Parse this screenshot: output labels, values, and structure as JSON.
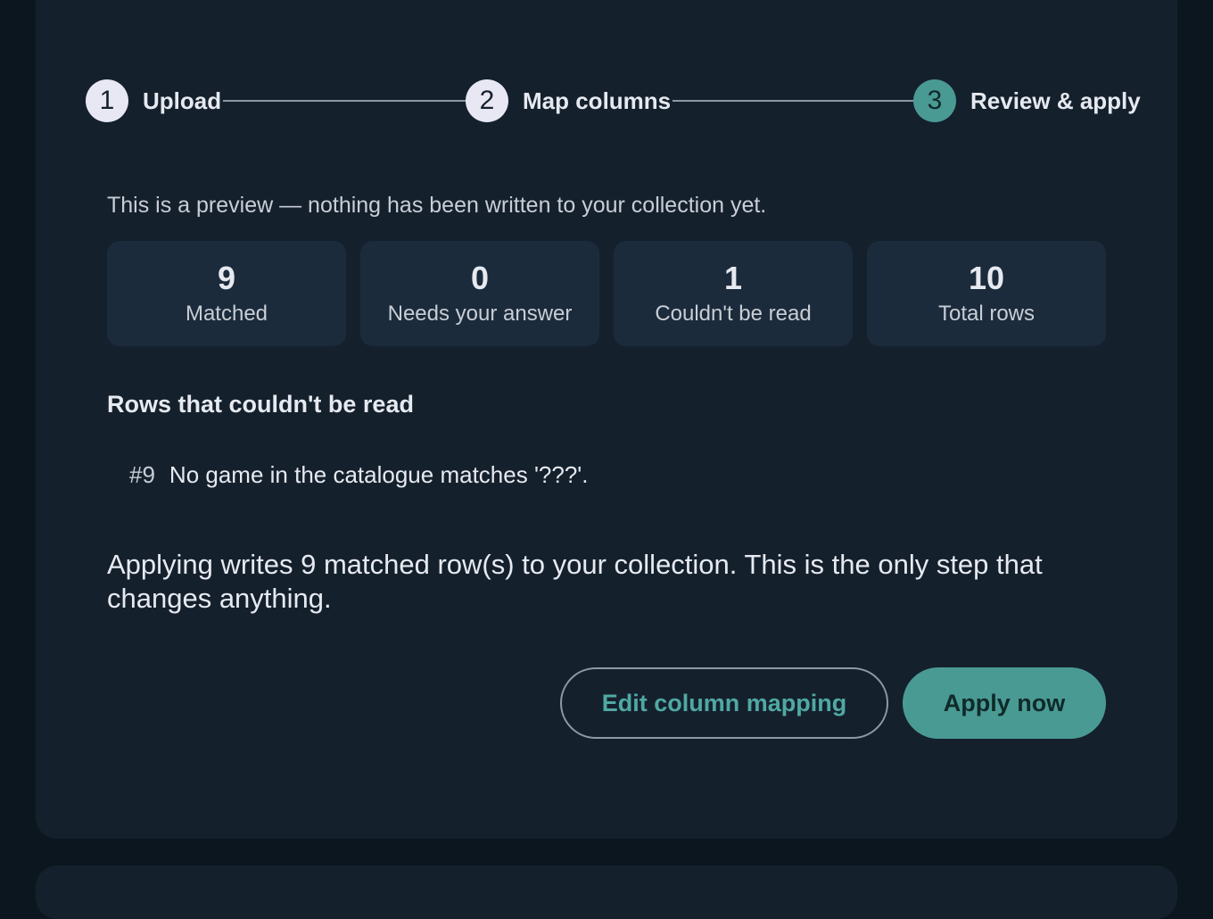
{
  "stepper": {
    "steps": [
      {
        "number": "1",
        "label": "Upload",
        "state": "done"
      },
      {
        "number": "2",
        "label": "Map columns",
        "state": "done"
      },
      {
        "number": "3",
        "label": "Review & apply",
        "state": "active"
      }
    ]
  },
  "preview_note": "This is a preview — nothing has been written to your collection yet.",
  "stats": [
    {
      "value": "9",
      "label": "Matched"
    },
    {
      "value": "0",
      "label": "Needs your answer"
    },
    {
      "value": "1",
      "label": "Couldn't be read"
    },
    {
      "value": "10",
      "label": "Total rows"
    }
  ],
  "errors": {
    "title": "Rows that couldn't be read",
    "rows": [
      {
        "row": "#9",
        "message": "No game in the catalogue matches '???'."
      }
    ]
  },
  "apply_note": "Applying writes 9 matched row(s) to your collection. This is the only step that changes anything.",
  "actions": {
    "edit_label": "Edit column mapping",
    "apply_label": "Apply now"
  },
  "colors": {
    "accent": "#4a9a94",
    "background": "#15202d",
    "card": "#1c2b3b"
  }
}
